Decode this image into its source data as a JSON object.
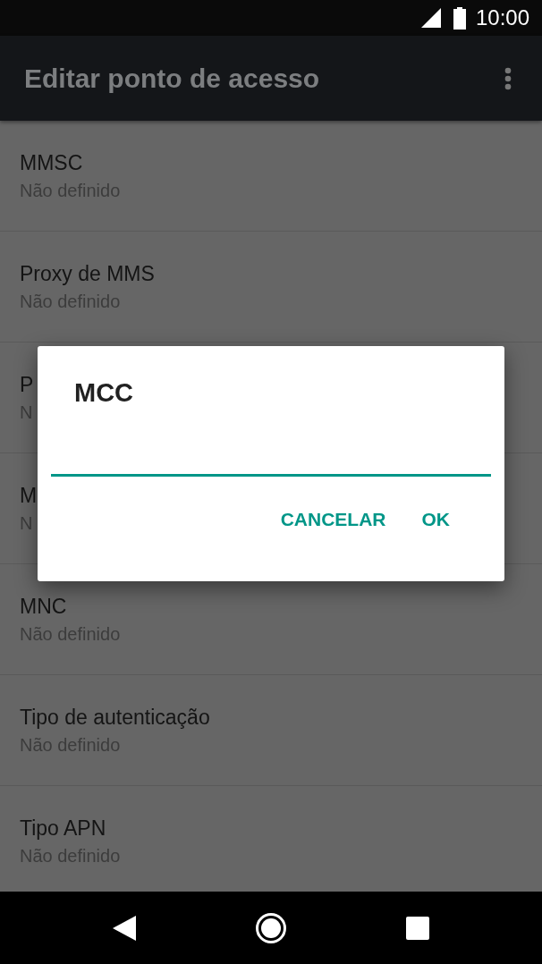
{
  "status_bar": {
    "time": "10:00"
  },
  "app_bar": {
    "title": "Editar ponto de acesso"
  },
  "settings": [
    {
      "title": "MMSC",
      "value": "Não definido"
    },
    {
      "title": "Proxy de MMS",
      "value": "Não definido"
    },
    {
      "title": "P",
      "value": "N"
    },
    {
      "title": "M",
      "value": "N"
    },
    {
      "title": "MNC",
      "value": "Não definido"
    },
    {
      "title": "Tipo de autenticação",
      "value": "Não definido"
    },
    {
      "title": "Tipo APN",
      "value": "Não definido"
    }
  ],
  "dialog": {
    "title": "MCC",
    "buttons": [
      "CANCELAR",
      "OK"
    ]
  }
}
